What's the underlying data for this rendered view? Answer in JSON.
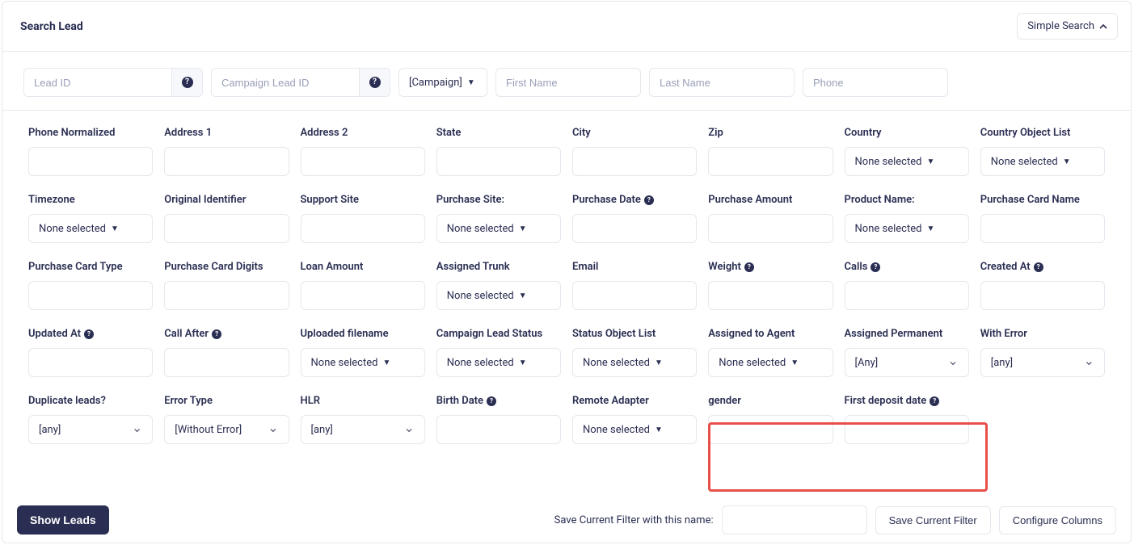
{
  "header": {
    "title": "Search Lead",
    "simple_search": "Simple Search"
  },
  "toprow": {
    "lead_id_ph": "Lead ID",
    "campaign_lead_id_ph": "Campaign Lead ID",
    "campaign_label": "[Campaign]",
    "first_name_ph": "First Name",
    "last_name_ph": "Last Name",
    "phone_ph": "Phone"
  },
  "none_selected": "None selected",
  "any": "[any]",
  "any_cap": "[Any]",
  "without_error": "[Without Error]",
  "fields": {
    "phone_normalized": "Phone Normalized",
    "address1": "Address 1",
    "address2": "Address 2",
    "state": "State",
    "city": "City",
    "zip": "Zip",
    "country": "Country",
    "country_obj": "Country Object List",
    "timezone": "Timezone",
    "original_identifier": "Original Identifier",
    "support_site": "Support Site",
    "purchase_site": "Purchase Site:",
    "purchase_date": "Purchase Date",
    "purchase_amount": "Purchase Amount",
    "product_name": "Product Name:",
    "purchase_card_name": "Purchase Card Name",
    "purchase_card_type": "Purchase Card Type",
    "purchase_card_digits": "Purchase Card Digits",
    "loan_amount": "Loan Amount",
    "assigned_trunk": "Assigned Trunk",
    "email": "Email",
    "weight": "Weight",
    "calls": "Calls",
    "created_at": "Created At",
    "updated_at": "Updated At",
    "call_after": "Call After",
    "uploaded_filename": "Uploaded filename",
    "campaign_lead_status": "Campaign Lead Status",
    "status_obj": "Status Object List",
    "assigned_agent": "Assigned to Agent",
    "assigned_permanent": "Assigned Permanent",
    "with_error": "With Error",
    "duplicate_leads": "Duplicate leads?",
    "error_type": "Error Type",
    "hlr": "HLR",
    "birth_date": "Birth Date",
    "remote_adapter": "Remote Adapter",
    "gender": "gender",
    "first_deposit_date": "First deposit date"
  },
  "footer": {
    "show_leads": "Show Leads",
    "save_label": "Save Current Filter with this name:",
    "save_btn": "Save Current Filter",
    "configure": "Configure Columns"
  }
}
